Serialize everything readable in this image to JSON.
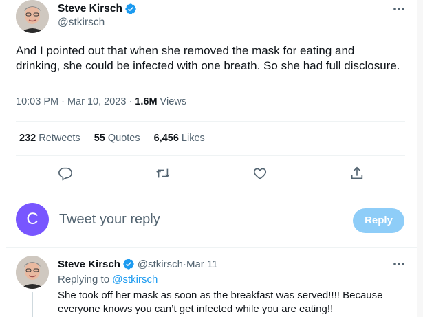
{
  "tweet": {
    "author_name": "Steve Kirsch",
    "author_handle": "@stkirsch",
    "text": "And I pointed out that when she removed the mask for eating and drinking, she could be infected with one breath. So she had full disclosure.",
    "time": "10:03 PM · Mar 10, 2023 · ",
    "views_count": "1.6M",
    "views_label": " Views"
  },
  "stats": {
    "retweets_count": "232",
    "retweets_label": " Retweets",
    "quotes_count": "55",
    "quotes_label": " Quotes",
    "likes_count": "6,456",
    "likes_label": " Likes"
  },
  "actions": [
    "reply-icon",
    "retweet-icon",
    "like-icon",
    "share-icon"
  ],
  "compose": {
    "avatar_letter": "C",
    "placeholder": "Tweet your reply",
    "button_label": "Reply"
  },
  "reply": {
    "author_name": "Steve Kirsch",
    "author_handle": "@stkirsch",
    "separator": " · ",
    "date": "Mar 11",
    "replying_prefix": "Replying to ",
    "replying_handle": "@stkirsch",
    "text": "She took off her mask as soon as the breakfast was served!!!! Because everyone knows you can’t get infected while you are eating!!"
  },
  "colors": {
    "accent": "#1d9bf0",
    "reply_button": "#8ecdf8",
    "compose_avatar": "#7856ff",
    "secondary_text": "#536471"
  }
}
